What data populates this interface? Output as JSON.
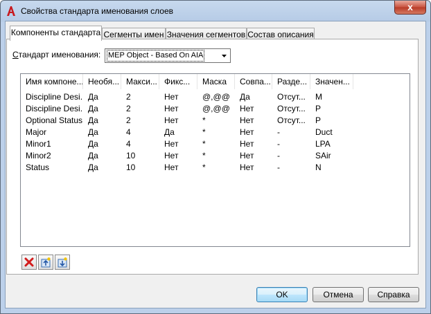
{
  "window": {
    "title": "Свойства стандарта именования слоев",
    "close_label": "x",
    "app_icon": "autocad-a-icon"
  },
  "tabs": [
    {
      "label": "Компоненты стандарта",
      "active": true
    },
    {
      "label": "Сегменты имен",
      "active": false
    },
    {
      "label": "Значения сегментов",
      "active": false
    },
    {
      "label": "Состав описания",
      "active": false
    }
  ],
  "naming_standard": {
    "label_prefix": "С",
    "label_rest": "тандарт именования:",
    "value": "MEP Object - Based On AIA"
  },
  "components_table": {
    "columns": [
      "Имя компоне...",
      "Необя...",
      "Макси...",
      "Фикс...",
      "Маска",
      "Совпа...",
      "Разде...",
      "Значен..."
    ],
    "rows": [
      [
        "Discipline Desi...",
        "Да",
        "2",
        "Нет",
        "@,@@",
        "Да",
        "Отсут...",
        "M"
      ],
      [
        "Discipline Desi...",
        "Да",
        "2",
        "Нет",
        "@,@@",
        "Нет",
        "Отсут...",
        "P"
      ],
      [
        "Optional Status",
        "Да",
        "2",
        "Нет",
        "*",
        "Нет",
        "Отсут...",
        "P"
      ],
      [
        "Major",
        "Да",
        "4",
        "Да",
        "*",
        "Нет",
        "-",
        "Duct"
      ],
      [
        "Minor1",
        "Да",
        "4",
        "Нет",
        "*",
        "Нет",
        "-",
        "LPA"
      ],
      [
        "Minor2",
        "Да",
        "10",
        "Нет",
        "*",
        "Нет",
        "-",
        "SAir"
      ],
      [
        "Status",
        "Да",
        "10",
        "Нет",
        "*",
        "Нет",
        "-",
        "N"
      ]
    ]
  },
  "toolbar": {
    "delete_icon": "delete-x-icon",
    "move_up_icon": "move-up-icon",
    "move_down_icon": "move-down-icon"
  },
  "buttons": {
    "ok": "OK",
    "cancel": "Отмена",
    "help": "Справка"
  }
}
